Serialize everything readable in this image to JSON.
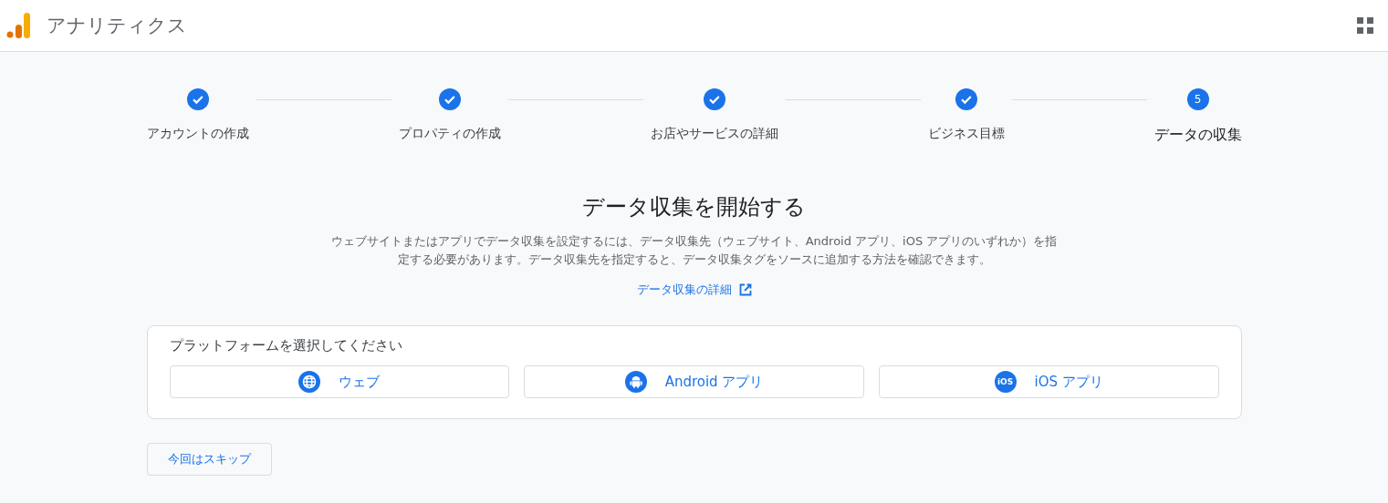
{
  "header": {
    "title": "アナリティクス"
  },
  "steps": [
    {
      "label": "アカウントの作成",
      "completed": true
    },
    {
      "label": "プロパティの作成",
      "completed": true
    },
    {
      "label": "お店やサービスの詳細",
      "completed": true
    },
    {
      "label": "ビジネス目標",
      "completed": true
    },
    {
      "label": "データの収集",
      "completed": false,
      "number": "5"
    }
  ],
  "heading": "データ収集を開始する",
  "description": "ウェブサイトまたはアプリでデータ収集を設定するには、データ収集先（ウェブサイト、Android アプリ、iOS アプリのいずれか）を指定する必要があります。データ収集先を指定すると、データ収集タグをソースに追加する方法を確認できます。",
  "learn_more_link": "データ収集の詳細",
  "platform_card": {
    "title": "プラットフォームを選択してください",
    "platforms": [
      {
        "kind": "web",
        "label": "ウェブ"
      },
      {
        "kind": "android",
        "label": "Android アプリ"
      },
      {
        "kind": "ios",
        "label": "iOS アプリ",
        "icon_text": "iOS"
      }
    ]
  },
  "skip_button": "今回はスキップ"
}
